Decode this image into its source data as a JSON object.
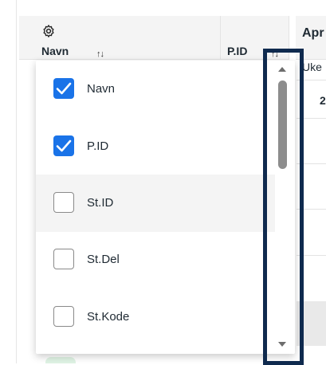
{
  "header": {
    "navn_label": "Navn",
    "pid_label": "P.ID",
    "sort_glyph": "↑↓",
    "month_label": "Apr",
    "week_label": "Uke",
    "day_label": "2"
  },
  "column_picker": {
    "options": [
      {
        "label": "Navn",
        "checked": true
      },
      {
        "label": "P.ID",
        "checked": true
      },
      {
        "label": "St.ID",
        "checked": false
      },
      {
        "label": "St.Del",
        "checked": false
      },
      {
        "label": "St.Kode",
        "checked": false
      }
    ],
    "scroll_fraction": 0.0
  },
  "colors": {
    "checkbox_checked": "#1a73e8",
    "highlight_row": "#f4f4f4",
    "focus_outline": "#0f2a4e"
  },
  "icons": [
    "gear-icon",
    "sort-icon",
    "check-icon",
    "scroll-up-icon",
    "scroll-down-icon"
  ]
}
